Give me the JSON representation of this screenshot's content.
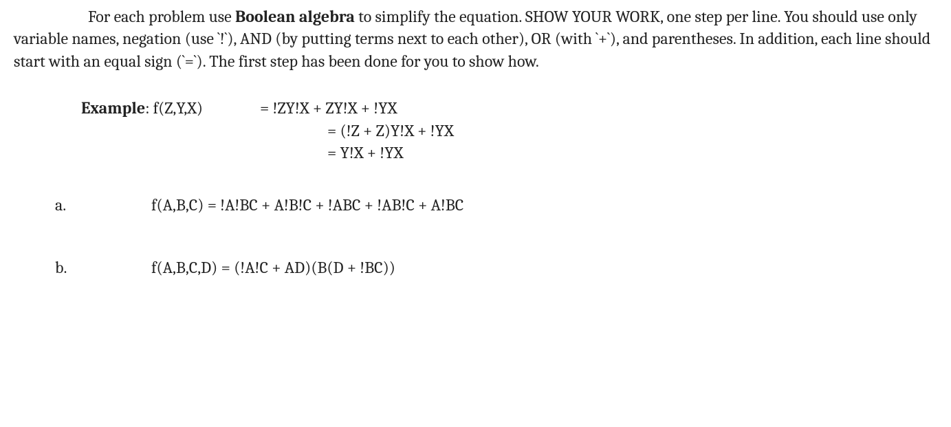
{
  "instructions": {
    "pre_bold": "For each problem use ",
    "bold": "Boolean algebra",
    "post_bold": " to simplify the equation. SHOW YOUR WORK, one step per line.  You should use only variable names, negation (use `!`), AND (by putting terms next to each other), OR (with `+`), and parentheses.  In addition, each line should start with an equal sign (`=`). The first step has been done for you to show how."
  },
  "example": {
    "label_bold": "Example",
    "label_rest": ": f(Z,Y,X)",
    "lines": [
      "= !ZY!X + ZY!X + !YX",
      "= (!Z + Z)Y!X + !YX",
      "= Y!X + !YX"
    ]
  },
  "problems": [
    {
      "letter": "a.",
      "expr": "f(A,B,C) = !A!BC + A!B!C + !ABC + !AB!C + A!BC"
    },
    {
      "letter": "b.",
      "expr": "f(A,B,C,D) = (!A!C + AD)(B(D + !BC))"
    }
  ]
}
